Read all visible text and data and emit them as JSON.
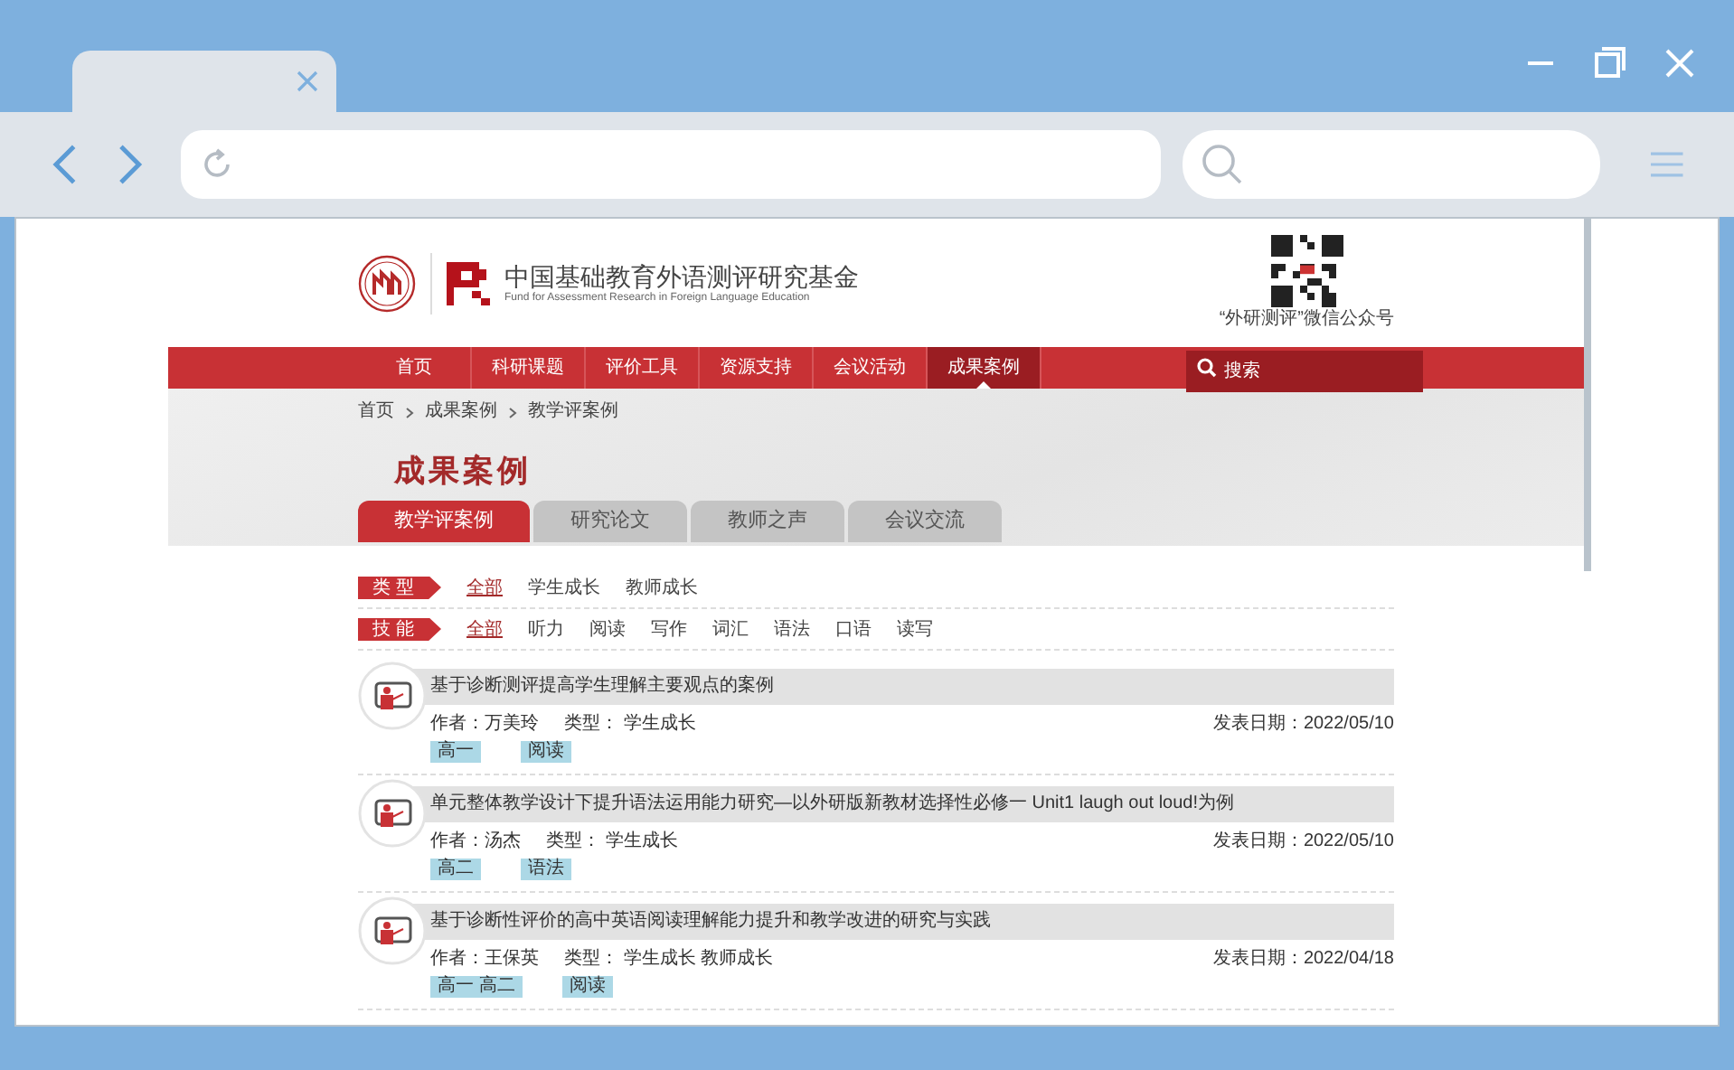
{
  "site": {
    "logo_title": "中国基础教育外语测评研究基金",
    "logo_subtitle": "Fund for Assessment Research in Foreign Language Education",
    "qr_caption": "“外研测评”微信公众号",
    "nav": [
      {
        "label": "首页",
        "selected": false
      },
      {
        "label": "科研课题",
        "selected": false
      },
      {
        "label": "评价工具",
        "selected": false
      },
      {
        "label": "资源支持",
        "selected": false
      },
      {
        "label": "会议活动",
        "selected": false
      },
      {
        "label": "成果案例",
        "selected": true
      }
    ],
    "search": {
      "placeholder": "搜索"
    },
    "breadcrumb": [
      "首页",
      "成果案例",
      "教学评案例"
    ],
    "page_title": "成果案例",
    "tabs": [
      {
        "label": "教学评案例",
        "selected": true
      },
      {
        "label": "研究论文",
        "selected": false
      },
      {
        "label": "教师之声",
        "selected": false
      },
      {
        "label": "会议交流",
        "selected": false
      }
    ],
    "filters": [
      {
        "label": "类 型",
        "options": [
          {
            "label": "全部",
            "selected": true
          },
          {
            "label": "学生成长",
            "selected": false
          },
          {
            "label": "教师成长",
            "selected": false
          }
        ]
      },
      {
        "label": "技 能",
        "options": [
          {
            "label": "全部",
            "selected": true
          },
          {
            "label": "听力",
            "selected": false
          },
          {
            "label": "阅读",
            "selected": false
          },
          {
            "label": "写作",
            "selected": false
          },
          {
            "label": "词汇",
            "selected": false
          },
          {
            "label": "语法",
            "selected": false
          },
          {
            "label": "口语",
            "selected": false
          },
          {
            "label": "读写",
            "selected": false
          }
        ]
      }
    ],
    "articles": [
      {
        "title": "基于诊断测评提高学生理解主要观点的案例",
        "author": "作者：万美玲",
        "type": "类型： 学生成长",
        "date": "发表日期：2022/05/10",
        "tags": [
          "高一",
          "阅读"
        ]
      },
      {
        "title": "单元整体教学设计下提升语法运用能力研究—以外研版新教材选择性必修一 Unit1 laugh out loud!为例",
        "author": "作者：汤杰",
        "type": "类型： 学生成长",
        "date": "发表日期：2022/05/10",
        "tags": [
          "高二",
          "语法"
        ]
      },
      {
        "title": "基于诊断性评价的高中英语阅读理解能力提升和教学改进的研究与实践",
        "author": "作者：王保英",
        "type": "类型： 学生成长 教师成长",
        "date": "发表日期：2022/04/18",
        "tags": [
          "高一 高二",
          "阅读"
        ]
      }
    ]
  }
}
